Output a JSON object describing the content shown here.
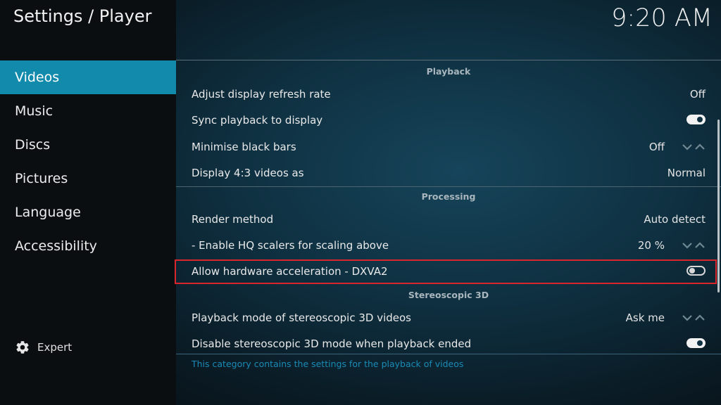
{
  "header": {
    "title": "Settings / Player",
    "clock": "9:20 AM"
  },
  "sidebar": {
    "items": [
      {
        "label": "Videos",
        "active": true
      },
      {
        "label": "Music"
      },
      {
        "label": "Discs"
      },
      {
        "label": "Pictures"
      },
      {
        "label": "Language"
      },
      {
        "label": "Accessibility"
      }
    ],
    "level_label": "Expert",
    "level_icon": "gear-icon"
  },
  "sections": {
    "playback": {
      "title": "Playback",
      "rows": [
        {
          "label": "Adjust display refresh rate",
          "value": "Off"
        },
        {
          "label": "Sync playback to display",
          "toggle": "on"
        },
        {
          "label": "Minimise black bars",
          "value": "Off",
          "spinner": true
        },
        {
          "label": "Display 4:3 videos as",
          "value": "Normal"
        }
      ]
    },
    "processing": {
      "title": "Processing",
      "rows": [
        {
          "label": "Render method",
          "value": "Auto detect"
        },
        {
          "label": "- Enable HQ scalers for scaling above",
          "value": "20 %",
          "spinner": true
        },
        {
          "label": "Allow hardware acceleration - DXVA2",
          "toggle": "off",
          "highlighted": true
        }
      ]
    },
    "stereo": {
      "title": "Stereoscopic 3D",
      "rows": [
        {
          "label": "Playback mode of stereoscopic 3D videos",
          "value": "Ask me",
          "spinner": true
        },
        {
          "label": "Disable stereoscopic 3D mode when playback ended",
          "toggle": "on"
        }
      ]
    }
  },
  "footer": {
    "description": "This category contains the settings for the playback of videos"
  },
  "colors": {
    "accent": "#128aab",
    "highlight_border": "#d9262c",
    "footer_text": "#1a8bb6"
  }
}
